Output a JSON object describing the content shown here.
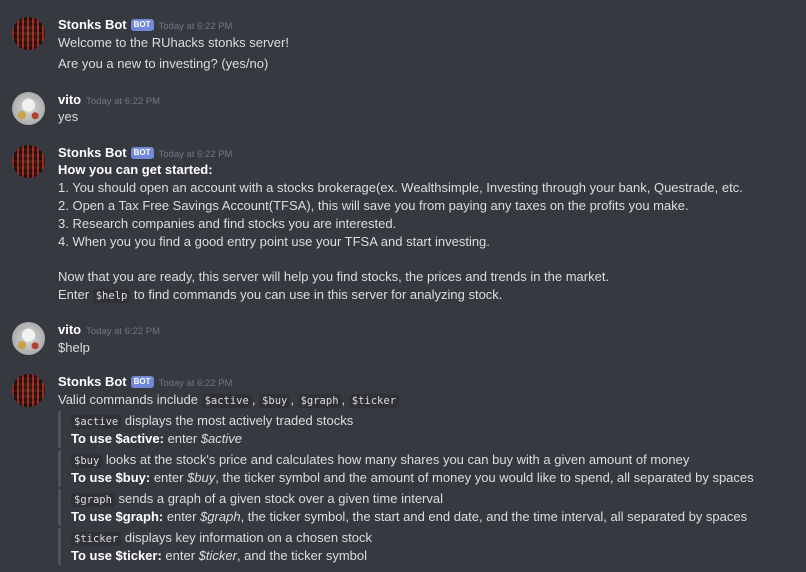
{
  "messages": {
    "m1": {
      "author": "Stonks Bot",
      "bot_tag": "BOT",
      "time": "Today at 6:22 PM",
      "lines": [
        "Welcome to the RUhacks stonks server!",
        "Are you a new to investing? (yes/no)"
      ]
    },
    "m2": {
      "author": "vito",
      "time": "Today at 6:22 PM",
      "lines": [
        "yes"
      ]
    },
    "m3": {
      "author": "Stonks Bot",
      "bot_tag": "BOT",
      "time": "Today at 6:22 PM",
      "heading": "How you can get started:",
      "steps": [
        "1. You should open an account with a stocks brokerage(ex. Wealthsimple, Investing through your bank, Questrade, etc.",
        "2. Open a Tax Free Savings Account(TFSA), this will save you from paying any taxes on the profits you make.",
        "3. Research companies and find stocks you are interested.",
        "4. When you you find a good entry point use your TFSA and start investing."
      ],
      "ready": "Now that you are ready, this server will help you find stocks, the prices and trends in the market.",
      "enter_pre": "Enter ",
      "enter_code": "$help",
      "enter_post": " to find commands you can use in this server for analyzing stock."
    },
    "m4": {
      "author": "vito",
      "time": "Today at 6:22 PM",
      "lines": [
        "$help"
      ]
    },
    "m5": {
      "author": "Stonks Bot",
      "bot_tag": "BOT",
      "time": "Today at 6:22 PM",
      "intro": "Valid commands include ",
      "intro_codes": [
        "$active",
        "$buy",
        "$graph",
        "$ticker"
      ],
      "sep": ", ",
      "commands": [
        {
          "code": "$active",
          "desc": " displays the most actively traded stocks",
          "use_label": "To use $active:",
          "use_pre": " enter ",
          "use_em": "$active",
          "use_post": ""
        },
        {
          "code": "$buy",
          "desc": " looks at the stock's price and calculates how many shares you can buy with a given amount of money",
          "use_label": "To use $buy:",
          "use_pre": " enter ",
          "use_em": "$buy",
          "use_post": ", the ticker symbol and the amount of money you would like to spend, all separated by spaces"
        },
        {
          "code": "$graph",
          "desc": " sends a graph of a given stock over a given time interval",
          "use_label": "To use $graph:",
          "use_pre": " enter ",
          "use_em": "$graph",
          "use_post": ", the ticker symbol, the start and end date, and the time interval, all separated by spaces"
        },
        {
          "code": "$ticker",
          "desc": " displays key information on a chosen stock",
          "use_label": "To use $ticker:",
          "use_pre": " enter ",
          "use_em": "$ticker",
          "use_post": ", and the ticker symbol"
        }
      ]
    }
  }
}
